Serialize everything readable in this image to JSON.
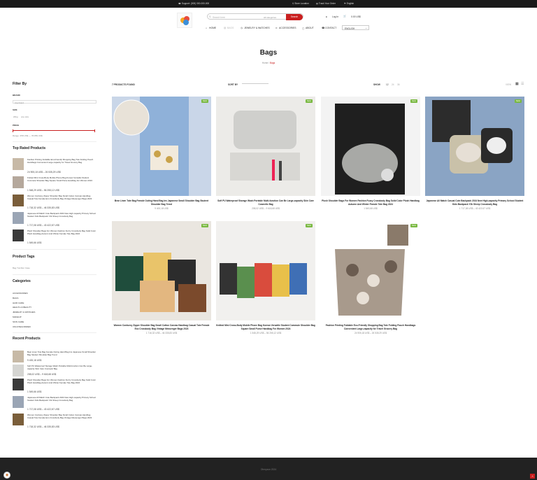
{
  "topbar": {
    "support": "Support: (000) 000-000-000",
    "store_location": "Store Location",
    "track_order": "Track Your Order",
    "language": "English"
  },
  "header": {
    "search_placeholder": "Search here",
    "search_category": "All categories",
    "search_button": "Search",
    "login": "Log In",
    "cart_amount": "0.00 US$",
    "cart_count": "0",
    "lang_select": "ENGLISH"
  },
  "nav": [
    "HOME",
    "BAGS",
    "JEWELRY & WATCHES",
    "ACCESSORIES",
    "ABOUT",
    "CONTACT"
  ],
  "page": {
    "title": "Bags",
    "crumb_home": "Home",
    "crumb_sep": "/",
    "crumb_current": "Bags"
  },
  "filter": {
    "title": "Filter By",
    "brand_label": "BRAND",
    "brand_placeholder": "Any brand",
    "size_label": "SIZE",
    "size_options": [
      "20kg",
      "one size"
    ],
    "price_label": "PRICE",
    "price_range": "Range: 458 US$ — 78,859 US$"
  },
  "top_rated": {
    "title": "Top Rated Products",
    "items": [
      {
        "name": "Fashion Printing Foldable Eco-Friendly Shopping Bag Tote Folding Pouch Handbags Convenient Large-capacity for Travel Grocery Bag",
        "price": "24 905,18 US$ – 26 535,29 US$"
      },
      {
        "name": "Knitted Mini Cross-Body Mobile Phone Bag Korean Versatile Student Commute Shoulder Bag Square Small Purse Handbag For Women 2024",
        "price": "1 548,29 US$ – 56 255,12 US$"
      },
      {
        "name": "Women Corduroy Zipper Shoulder Bag Small Cotton Canvas Handbag Casual Tote Female Eco Crossbody Bag Vintage Messenger Bags 2023",
        "price": "1 718,32 US$ – 46 335,83 US$"
      },
      {
        "name": "Japanese All Match Cute Backpack 2024 New High-capacity Primary School Student Kids Backpack Y2k Sheep Crossbody Bag",
        "price": "1 717,08 US$ – 43 422,67 US$"
      },
      {
        "name": "Plush Shoulder Bags For Women Fashion Fuzzy Crossbody Bag Solid Color Plush Handbag Autumn And Winter Female Tote Bag 2024",
        "price": "1 549,66 US$"
      }
    ]
  },
  "tags": {
    "title": "Product Tags",
    "items": "Bag  Tumbler  Case"
  },
  "categories": {
    "title": "Categories",
    "items": [
      "ACCESSORIES",
      "BAGS",
      "HAIR CARE",
      "HEALTH & BEAUTY",
      "JEWELRY & WATCHES",
      "MAKEUP",
      "SKIN CARE",
      "UNCATEGORIZED"
    ]
  },
  "recent": {
    "title": "Recent Products",
    "items": [
      {
        "name": "Bear Linen Tote Bag Female Outing Hand Bag Ins Japanese Small Shoulder Bag Student Shoulder Bag Trend",
        "price": "9 400,18 US$"
      },
      {
        "name": "Soft PU Waterproof Storage Wash Portable Multi-function Can Be Large-capacity Skin Care Cosmetic Bag",
        "price": "208,02 US$ – 9 618,68 US$"
      },
      {
        "name": "Plush Shoulder Bags For Women Fashion Fuzzy Crossbody Bag Solid Color Plush Handbag Autumn And Winter Female Tote Bag 2024",
        "price": "1 549,66 US$"
      },
      {
        "name": "Japanese All Match Cute Backpack 2024 New High-capacity Primary School Student Kids Backpack Y2k Sheep Crossbody Bag",
        "price": "1 717,08 US$ – 43 422,67 US$"
      },
      {
        "name": "Women Corduroy Zipper Shoulder Bag Small Cotton Canvas Handbag Casual Tote Female Eco Crossbody Bag Vintage Messenger Bags 2023",
        "price": "1 718,32 US$ – 46 335,83 US$"
      }
    ]
  },
  "toolbar": {
    "found": "7 PRODUCTS FOUND",
    "sort_label": "SORT BY",
    "sort_value": "POPULARITY",
    "show_label": "SHOW",
    "show_options": [
      "12",
      "24",
      "36"
    ],
    "view_label": "VIEW"
  },
  "products": [
    {
      "title": "Bear Linen Tote Bag Female Outing Hand Bag Ins Japanese Small Shoulder Bag Student Shoulder Bag Trend",
      "price": "9 400,18 US$",
      "badge": "Sale!"
    },
    {
      "title": "Soft PU Waterproof Storage Wash Portable Multi-function Can Be Large-capacity Skin Care Cosmetic Bag",
      "price": "208,02 US$ – 9 618,68 US$",
      "badge": "Sale!"
    },
    {
      "title": "Plush Shoulder Bags For Women Fashion Fuzzy Crossbody Bag Solid Color Plush Handbag Autumn And Winter Female Tote Bag 2024",
      "price": "1 549,66 US$",
      "badge": "Sale!"
    },
    {
      "title": "Japanese All Match Casual Cute Backpack 2024 New High-capacity Primary School Student Kids Backpack Y2k Sheep Crossbody Bag",
      "price": "1 717,08 US$ – 43 422,67 US$",
      "badge": "Sale!"
    },
    {
      "title": "Women Corduroy Zipper Shoulder Bag Small Cotton Canvas Handbag Casual Tote Female Eco Crossbody Bag Vintage Messenger Bags 2023",
      "price": "1 718,32 US$ – 46 335,83 US$",
      "badge": "Sale!"
    },
    {
      "title": "Knitted Mini Cross-Body Mobile Phone Bag Korean Versatile Student Commute Shoulder Bag Square Small Purse Handbag For Women 2024",
      "price": "1 548,29 US$ – 56 255,12 US$",
      "badge": "Sale!"
    },
    {
      "title": "Fashion Printing Foldable Eco-Friendly Shopping Bag Tote Folding Pouch Handbags Convenient Large-capacity for Travel Grocery Bag",
      "price": "24 905,18 US$ – 26 535,29 US$",
      "badge": "Sale!"
    }
  ],
  "footer": {
    "copyright": "Ohmyzon 2024"
  }
}
